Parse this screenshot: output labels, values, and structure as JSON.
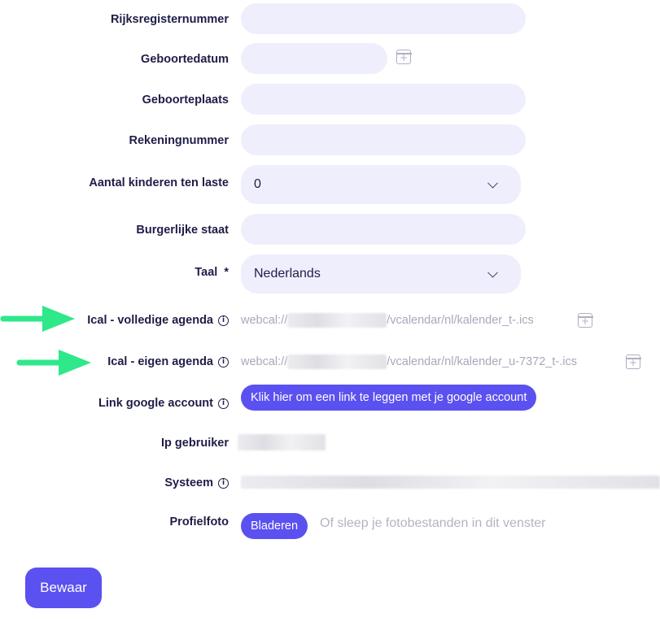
{
  "form": {
    "rijksregister": {
      "label": "Rijksregisternummer",
      "value": ""
    },
    "geboortedatum": {
      "label": "Geboortedatum",
      "value": "",
      "icon": "calendar-plus-icon"
    },
    "geboorteplaats": {
      "label": "Geboorteplaats",
      "value": ""
    },
    "rekeningnummer": {
      "label": "Rekeningnummer",
      "value": ""
    },
    "kinderen": {
      "label": "Aantal kinderen ten laste",
      "value": "0"
    },
    "burgerlijke_staat": {
      "label": "Burgerlijke staat",
      "value": ""
    },
    "taal": {
      "label": "Taal",
      "required_mark": "*",
      "value": "Nederlands"
    },
    "ical_volledig": {
      "label": "Ical - volledige agenda",
      "prefix": "webcal://",
      "suffix": "/vcalendar/nl/kalender_t-.ics",
      "icon": "calendar-plus-icon"
    },
    "ical_eigen": {
      "label": "Ical - eigen agenda",
      "prefix": "webcal://",
      "suffix": "/vcalendar/nl/kalender_u-7372_t-.ics",
      "icon": "calendar-plus-icon"
    },
    "google": {
      "label": "Link google account",
      "button": "Klik hier om een link te leggen met je google account"
    },
    "ip": {
      "label": "Ip gebruiker"
    },
    "systeem": {
      "label": "Systeem"
    },
    "profielfoto": {
      "label": "Profielfoto",
      "button": "Bladeren",
      "hint": "Of sleep je fotobestanden in dit venster"
    }
  },
  "actions": {
    "save": "Bewaar"
  },
  "colors": {
    "accent": "#5b50f0",
    "field_bg": "#efeefc",
    "label": "#1f1d47",
    "muted": "#a9a8bb",
    "annotation_arrow": "#2ee88a"
  }
}
